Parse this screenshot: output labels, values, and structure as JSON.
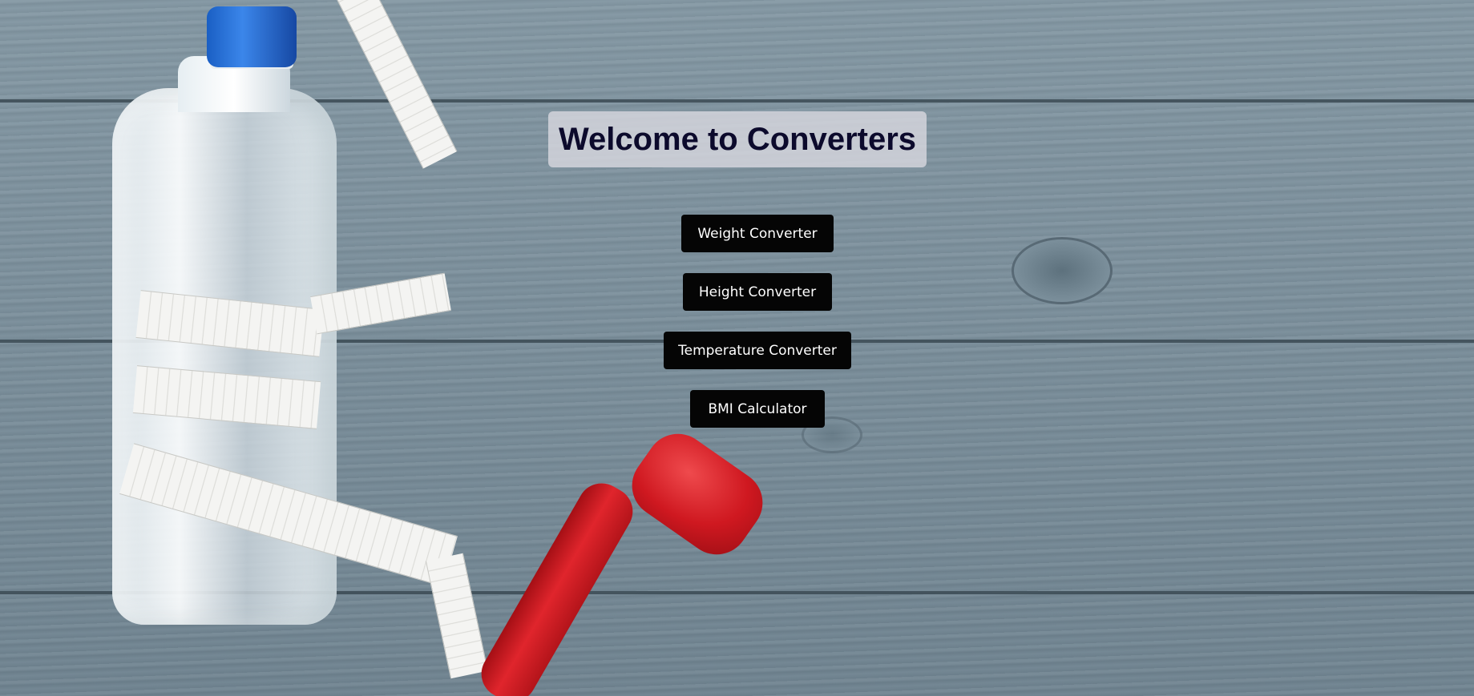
{
  "page": {
    "title": "Welcome to Converters"
  },
  "nav": {
    "buttons": [
      {
        "label": "Weight Converter"
      },
      {
        "label": "Height Converter"
      },
      {
        "label": "Temperature Converter"
      },
      {
        "label": "BMI Calculator"
      }
    ]
  },
  "colors": {
    "title_text": "#0c0a2c",
    "title_box": "#d7d7de",
    "button_bg": "#050505",
    "button_text": "#ffffff"
  }
}
